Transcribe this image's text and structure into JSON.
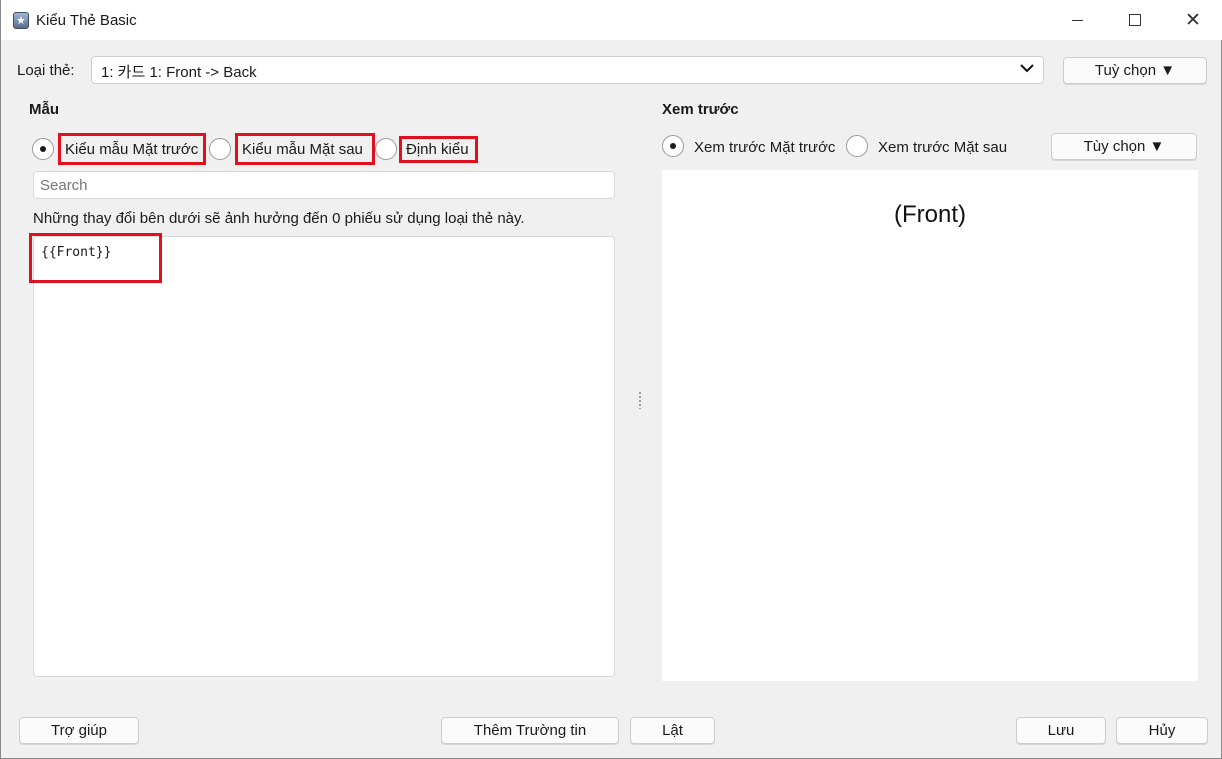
{
  "window": {
    "title": "Kiểu Thẻ Basic",
    "minimize_glyph": "—",
    "maximize_glyph": "□",
    "close_glyph": "✕"
  },
  "note_type": {
    "label": "Loại thẻ:",
    "selected": "1: 카드 1: Front -> Back",
    "options_button": "Tuỳ chọn ▼"
  },
  "template": {
    "title": "Mẫu",
    "radios": [
      {
        "label": "Kiểu mẫu Mặt trước",
        "checked": true
      },
      {
        "label": "Kiểu mẫu Mặt sau",
        "checked": false
      },
      {
        "label": "Định kiểu",
        "checked": false
      }
    ],
    "search_placeholder": "Search",
    "info": "Những thay đổi bên dưới sẽ ảnh hưởng đến 0 phiếu sử dụng loại thẻ này.",
    "code": "{{Front}}"
  },
  "preview": {
    "title": "Xem trước",
    "radios": [
      {
        "label": "Xem trước Mặt trước",
        "checked": true
      },
      {
        "label": "Xem trước Mặt sau",
        "checked": false
      }
    ],
    "options_button": "Tùy chọn ▼",
    "content": "(Front)"
  },
  "footer": {
    "help": "Trợ giúp",
    "add_field": "Thêm Trường tin",
    "flip": "Lật",
    "save": "Lưu",
    "cancel": "Hủy"
  },
  "colors": {
    "highlight": "#e0101e",
    "background": "#f0f0f0"
  },
  "icons": {
    "app": "anki-star-icon",
    "dropdown": "chevron-down-icon",
    "splitter": "drag-handle-icon"
  }
}
